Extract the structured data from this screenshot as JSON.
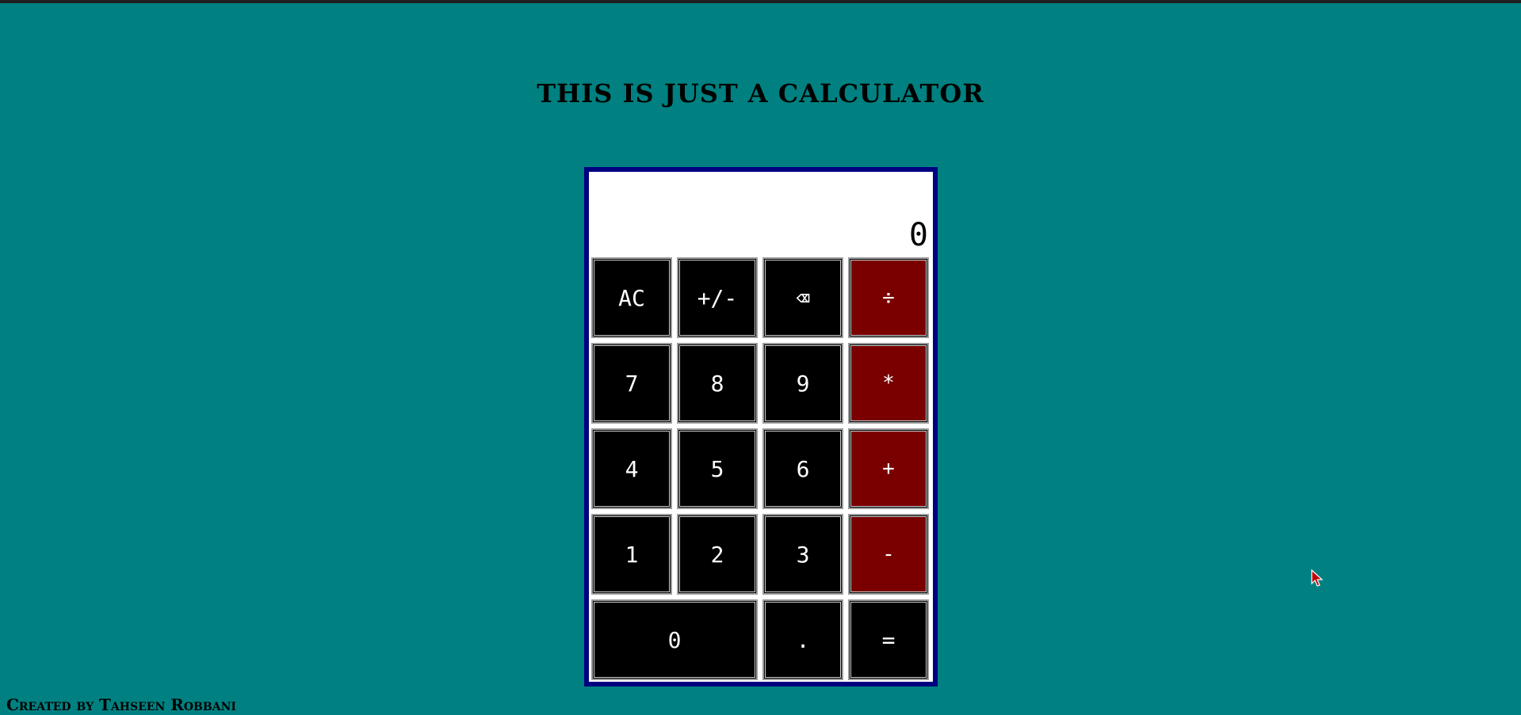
{
  "page": {
    "title": "THIS IS JUST A CALCULATOR",
    "footer": "Created by Tahseen Robbani"
  },
  "display": {
    "value": "0"
  },
  "keys": {
    "ac": "AC",
    "sign": "+/-",
    "backspace": "⌫",
    "divide": "÷",
    "seven": "7",
    "eight": "8",
    "nine": "9",
    "multiply": "*",
    "four": "4",
    "five": "5",
    "six": "6",
    "add": "+",
    "one": "1",
    "two": "2",
    "three": "3",
    "subtract": "-",
    "zero": "0",
    "decimal": ".",
    "equals": "="
  },
  "colors": {
    "background": "#008080",
    "frame": "#000080",
    "key": "#000000",
    "operator_key": "#7a0000",
    "key_text": "#ffffff"
  },
  "icons": {
    "cursor": "mouse-pointer-icon",
    "backspace": "backspace-icon"
  }
}
